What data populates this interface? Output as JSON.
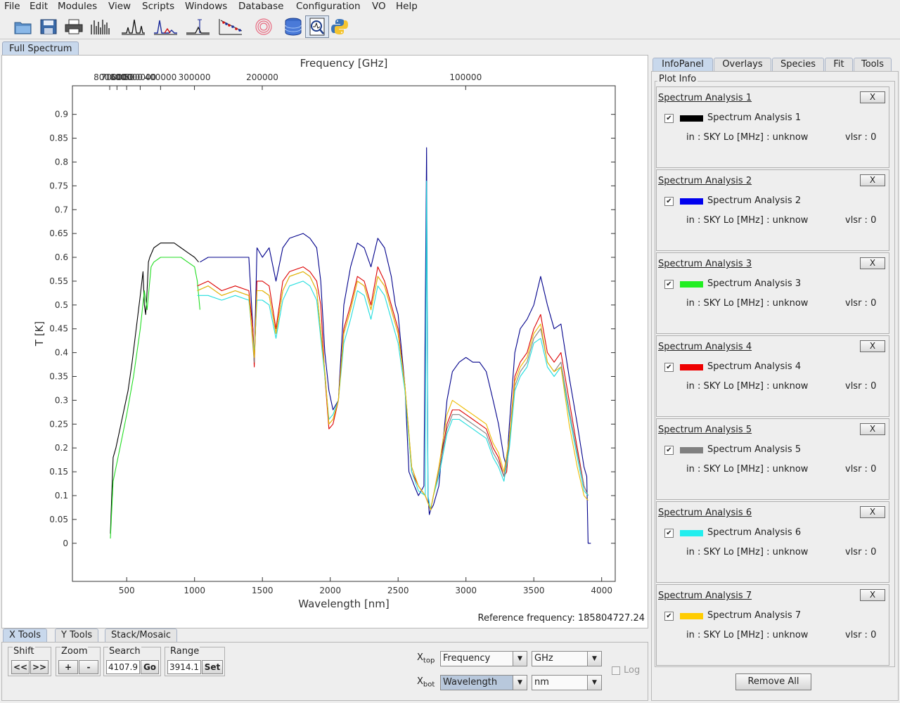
{
  "menubar": [
    "File",
    "Edit",
    "Modules",
    "View",
    "Scripts",
    "Windows",
    "Database",
    "Configuration",
    "VO",
    "Help"
  ],
  "toolbar_icons": [
    "open-folder-icon",
    "save-icon",
    "print-icon",
    "full-spectrum-icon",
    "line-spectrum-icon",
    "spectrum-analysis-icon",
    "line-id-icon",
    "rotational-diagram-icon",
    "loomis-wood-icon",
    "database-icon",
    "spectrum-viewer-icon",
    "python-icon"
  ],
  "main_tab": "Full Spectrum",
  "chart_data": {
    "type": "line",
    "xlabel": "Wavelength [nm]",
    "x2label": "Frequency [GHz]",
    "ylabel": "T [K]",
    "xlim": [
      100,
      4100
    ],
    "ylim": [
      -0.08,
      0.96
    ],
    "x_ticks": [
      "500",
      "1000",
      "1500",
      "2000",
      "2500",
      "3000",
      "3500",
      "4000"
    ],
    "x_tick_values": [
      500,
      1000,
      1500,
      2000,
      2500,
      3000,
      3500,
      4000
    ],
    "x2_ticks": [
      "800000",
      "700000",
      "600000",
      "500000",
      "400000",
      "300000",
      "200000",
      "100000"
    ],
    "x2_tick_values": [
      800000,
      700000,
      600000,
      500000,
      400000,
      300000,
      200000,
      100000
    ],
    "y_ticks": [
      "0",
      "0.05",
      "0.1",
      "0.15",
      "0.2",
      "0.25",
      "0.3",
      "0.35",
      "0.4",
      "0.45",
      "0.5",
      "0.55",
      "0.6",
      "0.65",
      "0.7",
      "0.75",
      "0.8",
      "0.85",
      "0.9"
    ],
    "y_tick_values": [
      0,
      0.05,
      0.1,
      0.15,
      0.2,
      0.25,
      0.3,
      0.35,
      0.4,
      0.45,
      0.5,
      0.55,
      0.6,
      0.65,
      0.7,
      0.75,
      0.8,
      0.85,
      0.9
    ],
    "grid": false,
    "series": [
      {
        "color": "#000000",
        "x": [
          380,
          400,
          420,
          450,
          480,
          510,
          540,
          570,
          600,
          620,
          630,
          640,
          650,
          660,
          670,
          700,
          750,
          800,
          850,
          900,
          950,
          1000,
          1030
        ],
        "y": [
          0.02,
          0.18,
          0.2,
          0.24,
          0.28,
          0.32,
          0.38,
          0.45,
          0.52,
          0.57,
          0.5,
          0.48,
          0.53,
          0.59,
          0.6,
          0.62,
          0.63,
          0.63,
          0.63,
          0.62,
          0.61,
          0.6,
          0.59
        ]
      },
      {
        "color": "#00008b",
        "x": [
          1040,
          1100,
          1200,
          1300,
          1400,
          1430,
          1440,
          1460,
          1500,
          1550,
          1600,
          1650,
          1700,
          1800,
          1850,
          1900,
          1930,
          1960,
          1990,
          2020,
          2060,
          2100,
          2150,
          2200,
          2250,
          2300,
          2350,
          2400,
          2450,
          2480,
          2500,
          2550,
          2580,
          2620,
          2650,
          2690,
          2710,
          2720,
          2730,
          2740,
          2760,
          2800,
          2860,
          2900,
          2950,
          3000,
          3050,
          3100,
          3150,
          3200,
          3240,
          3280,
          3300,
          3320,
          3360,
          3400,
          3450,
          3500,
          3550,
          3600,
          3650,
          3700,
          3760,
          3820,
          3870,
          3890,
          3900,
          3920
        ],
        "y": [
          0.59,
          0.6,
          0.6,
          0.6,
          0.6,
          0.45,
          0.38,
          0.62,
          0.6,
          0.62,
          0.55,
          0.62,
          0.64,
          0.65,
          0.64,
          0.62,
          0.55,
          0.4,
          0.32,
          0.28,
          0.3,
          0.5,
          0.58,
          0.63,
          0.62,
          0.58,
          0.64,
          0.62,
          0.56,
          0.5,
          0.48,
          0.33,
          0.15,
          0.12,
          0.1,
          0.12,
          0.83,
          0.1,
          0.06,
          0.07,
          0.08,
          0.12,
          0.3,
          0.36,
          0.38,
          0.39,
          0.38,
          0.38,
          0.36,
          0.3,
          0.25,
          0.18,
          0.16,
          0.25,
          0.4,
          0.45,
          0.47,
          0.5,
          0.56,
          0.5,
          0.45,
          0.46,
          0.35,
          0.25,
          0.16,
          0.14,
          0.0,
          0.0
        ]
      },
      {
        "color": "#22dd22",
        "x": [
          380,
          400,
          450,
          500,
          550,
          600,
          630,
          650,
          680,
          700,
          750,
          800,
          850,
          900,
          950,
          1000,
          1020,
          1040
        ],
        "y": [
          0.01,
          0.13,
          0.2,
          0.27,
          0.35,
          0.45,
          0.53,
          0.49,
          0.58,
          0.59,
          0.6,
          0.6,
          0.6,
          0.6,
          0.59,
          0.58,
          0.55,
          0.49
        ]
      },
      {
        "color": "#dd0000",
        "x": [
          1020,
          1100,
          1200,
          1300,
          1400,
          1430,
          1440,
          1460,
          1500,
          1550,
          1600,
          1650,
          1700,
          1800,
          1850,
          1900,
          1930,
          1960,
          1990,
          2020,
          2060,
          2100,
          2150,
          2200,
          2250,
          2300,
          2350,
          2400,
          2450,
          2500,
          2550,
          2600,
          2650,
          2700,
          2740,
          2760,
          2800,
          2860,
          2900,
          2950,
          3000,
          3050,
          3100,
          3150,
          3200,
          3240,
          3280,
          3300,
          3320,
          3360,
          3400,
          3450,
          3500,
          3550,
          3600,
          3650,
          3700,
          3760,
          3820,
          3870,
          3900
        ],
        "y": [
          0.54,
          0.55,
          0.53,
          0.54,
          0.53,
          0.45,
          0.37,
          0.55,
          0.55,
          0.54,
          0.45,
          0.55,
          0.57,
          0.58,
          0.57,
          0.55,
          0.5,
          0.35,
          0.24,
          0.25,
          0.3,
          0.45,
          0.5,
          0.56,
          0.55,
          0.5,
          0.58,
          0.55,
          0.5,
          0.45,
          0.33,
          0.15,
          0.12,
          0.1,
          0.07,
          0.1,
          0.15,
          0.25,
          0.28,
          0.28,
          0.27,
          0.26,
          0.25,
          0.24,
          0.2,
          0.18,
          0.14,
          0.15,
          0.22,
          0.35,
          0.38,
          0.4,
          0.45,
          0.48,
          0.4,
          0.38,
          0.4,
          0.3,
          0.2,
          0.12,
          0.1
        ]
      },
      {
        "color": "#808080",
        "x": [
          1020,
          1100,
          1200,
          1300,
          1400,
          1440,
          1460,
          1500,
          1550,
          1600,
          1650,
          1700,
          1800,
          1850,
          1900,
          1960,
          1990,
          2020,
          2060,
          2100,
          2150,
          2200,
          2250,
          2300,
          2350,
          2400,
          2450,
          2500,
          2550,
          2600,
          2650,
          2700,
          2740,
          2760,
          2800,
          2860,
          2900,
          2950,
          3000,
          3050,
          3100,
          3150,
          3200,
          3240,
          3280,
          3320,
          3360,
          3400,
          3450,
          3500,
          3550,
          3600,
          3650,
          3700,
          3760,
          3820,
          3870,
          3900
        ],
        "y": [
          0.53,
          0.54,
          0.52,
          0.53,
          0.52,
          0.38,
          0.53,
          0.53,
          0.52,
          0.44,
          0.53,
          0.56,
          0.57,
          0.56,
          0.53,
          0.36,
          0.25,
          0.26,
          0.3,
          0.44,
          0.49,
          0.55,
          0.54,
          0.49,
          0.56,
          0.54,
          0.49,
          0.44,
          0.33,
          0.16,
          0.12,
          0.1,
          0.07,
          0.1,
          0.15,
          0.24,
          0.27,
          0.27,
          0.26,
          0.25,
          0.24,
          0.23,
          0.19,
          0.17,
          0.14,
          0.21,
          0.33,
          0.36,
          0.38,
          0.43,
          0.45,
          0.38,
          0.36,
          0.38,
          0.28,
          0.19,
          0.12,
          0.1
        ]
      },
      {
        "color": "#22dddd",
        "x": [
          1020,
          1100,
          1200,
          1300,
          1400,
          1440,
          1460,
          1500,
          1550,
          1600,
          1650,
          1700,
          1800,
          1850,
          1900,
          1960,
          1990,
          2020,
          2060,
          2100,
          2150,
          2200,
          2250,
          2300,
          2350,
          2400,
          2450,
          2500,
          2550,
          2600,
          2650,
          2700,
          2710,
          2720,
          2740,
          2760,
          2800,
          2860,
          2900,
          2950,
          3000,
          3050,
          3100,
          3150,
          3200,
          3240,
          3280,
          3320,
          3360,
          3400,
          3450,
          3500,
          3550,
          3600,
          3650,
          3700,
          3760,
          3820,
          3870,
          3900
        ],
        "y": [
          0.52,
          0.52,
          0.51,
          0.52,
          0.51,
          0.4,
          0.51,
          0.51,
          0.5,
          0.43,
          0.51,
          0.54,
          0.55,
          0.54,
          0.51,
          0.35,
          0.26,
          0.27,
          0.3,
          0.42,
          0.47,
          0.53,
          0.52,
          0.47,
          0.54,
          0.52,
          0.47,
          0.42,
          0.32,
          0.15,
          0.11,
          0.1,
          0.76,
          0.1,
          0.07,
          0.1,
          0.14,
          0.23,
          0.26,
          0.26,
          0.25,
          0.24,
          0.23,
          0.22,
          0.18,
          0.16,
          0.13,
          0.2,
          0.32,
          0.35,
          0.37,
          0.42,
          0.43,
          0.37,
          0.35,
          0.37,
          0.27,
          0.18,
          0.11,
          0.1
        ]
      },
      {
        "color": "#eebb00",
        "x": [
          1020,
          1100,
          1200,
          1300,
          1400,
          1440,
          1460,
          1500,
          1550,
          1600,
          1650,
          1700,
          1800,
          1850,
          1900,
          1960,
          1990,
          2020,
          2060,
          2100,
          2150,
          2200,
          2250,
          2300,
          2350,
          2400,
          2450,
          2500,
          2550,
          2600,
          2650,
          2700,
          2740,
          2760,
          2800,
          2860,
          2900,
          2950,
          3000,
          3050,
          3100,
          3150,
          3200,
          3240,
          3280,
          3320,
          3360,
          3400,
          3450,
          3500,
          3550,
          3600,
          3650,
          3700,
          3760,
          3820,
          3870,
          3900
        ],
        "y": [
          0.53,
          0.54,
          0.52,
          0.53,
          0.52,
          0.39,
          0.53,
          0.53,
          0.52,
          0.44,
          0.53,
          0.56,
          0.57,
          0.56,
          0.53,
          0.36,
          0.25,
          0.26,
          0.3,
          0.44,
          0.49,
          0.55,
          0.54,
          0.49,
          0.56,
          0.54,
          0.49,
          0.44,
          0.33,
          0.16,
          0.12,
          0.1,
          0.07,
          0.1,
          0.16,
          0.27,
          0.3,
          0.29,
          0.28,
          0.27,
          0.26,
          0.25,
          0.21,
          0.19,
          0.15,
          0.22,
          0.34,
          0.37,
          0.39,
          0.44,
          0.46,
          0.38,
          0.36,
          0.37,
          0.25,
          0.16,
          0.1,
          0.09
        ]
      }
    ]
  },
  "reference": {
    "label": "Reference frequency:",
    "value": "185804727.24"
  },
  "bottom_tabs": [
    "X Tools",
    "Y Tools",
    "Stack/Mosaic"
  ],
  "xtools": {
    "shift_title": "Shift",
    "shift_left": "<<",
    "shift_right": ">>",
    "zoom_title": "Zoom",
    "zoom_in": "+",
    "zoom_out": "-",
    "search_title": "Search",
    "search_value": "4107.9",
    "search_go": "Go",
    "range_title": "Range",
    "range_value": "3914.1",
    "range_set": "Set",
    "xtop_main": "X",
    "xtop_sub": "top",
    "xtop_axis": "Frequency",
    "xtop_unit": "GHz",
    "xbot_main": "X",
    "xbot_sub": "bot",
    "xbot_axis": "Wavelength",
    "xbot_unit": "nm",
    "log_label": "Log"
  },
  "right_tabs": [
    "InfoPanel",
    "Overlays",
    "Species",
    "Fit",
    "Tools"
  ],
  "plot_info_title": "Plot Info",
  "spectra": [
    {
      "title": "Spectrum Analysis 1",
      "name": "Spectrum Analysis 1",
      "color": "#000000",
      "info": "in : SKY Lo [MHz] : unknow",
      "vlsr": "vlsr : 0",
      "close": "X",
      "check": "✔"
    },
    {
      "title": "Spectrum Analysis 2",
      "name": "Spectrum Analysis 2",
      "color": "#0000ee",
      "info": "in : SKY Lo [MHz] : unknow",
      "vlsr": "vlsr : 0",
      "close": "X",
      "check": "✔"
    },
    {
      "title": "Spectrum Analysis 3",
      "name": "Spectrum Analysis 3",
      "color": "#22ee22",
      "info": "in : SKY Lo [MHz] : unknow",
      "vlsr": "vlsr : 0",
      "close": "X",
      "check": "✔"
    },
    {
      "title": "Spectrum Analysis 4",
      "name": "Spectrum Analysis 4",
      "color": "#ee0000",
      "info": "in : SKY Lo [MHz] : unknow",
      "vlsr": "vlsr : 0",
      "close": "X",
      "check": "✔"
    },
    {
      "title": "Spectrum Analysis 5",
      "name": "Spectrum Analysis 5",
      "color": "#808080",
      "info": "in : SKY Lo [MHz] : unknow",
      "vlsr": "vlsr : 0",
      "close": "X",
      "check": "✔"
    },
    {
      "title": "Spectrum Analysis 6",
      "name": "Spectrum Analysis 6",
      "color": "#22eeee",
      "info": "in : SKY Lo [MHz] : unknow",
      "vlsr": "vlsr : 0",
      "close": "X",
      "check": "✔"
    },
    {
      "title": "Spectrum Analysis 7",
      "name": "Spectrum Analysis 7",
      "color": "#ffcc00",
      "info": "in : SKY Lo [MHz] : unknow",
      "vlsr": "vlsr : 0",
      "close": "X",
      "check": "✔"
    }
  ],
  "remove_all": "Remove All"
}
